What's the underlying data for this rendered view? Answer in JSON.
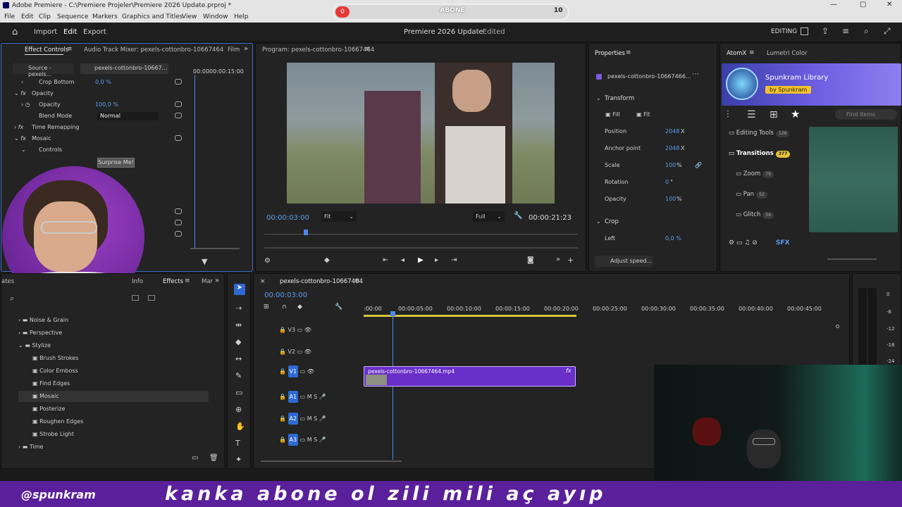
{
  "app": {
    "title": "Adobe Premiere - C:\\Premiere Projeler\\Premiere 2026 Update.prproj *",
    "menu": [
      "File",
      "Edit",
      "Clip",
      "Sequence",
      "Markers",
      "Graphics and Titles",
      "View",
      "Window",
      "Help"
    ]
  },
  "overlay": {
    "sub_left": "0",
    "sub_label": "ABONE",
    "sub_right": "10",
    "handle": "@spunkram",
    "ticker": "kanka abone ol zili mili aç ayıp"
  },
  "header": {
    "nav": [
      "Import",
      "Edit",
      "Export"
    ],
    "project": "Premiere 2026 Update",
    "status": "- Edited",
    "workspace": "EDITING"
  },
  "effect_controls": {
    "tabs": [
      "Effect Controls",
      "Audio Track Mixer: pexels-cottonbro-10667464",
      "Film"
    ],
    "source": "Source - pexels...",
    "clip": "pexels-cottonbro-10667...",
    "time_start": "00:00",
    "time_end": "00:00:15:00",
    "rows": [
      {
        "label": "Crop Bottom",
        "value": "0,0 %"
      },
      {
        "label": "Opacity",
        "value": ""
      },
      {
        "label": "Opacity",
        "value": "100,0 %"
      },
      {
        "label": "Blend Mode",
        "value": "Normal"
      },
      {
        "label": "Time Remapping",
        "value": ""
      },
      {
        "label": "Mosaic",
        "value": ""
      },
      {
        "label": "Controls",
        "value": ""
      }
    ],
    "tooltip": "Surprise Me!"
  },
  "program": {
    "title": "Program: pexels-cottonbro-10667464",
    "timecode": "00:00:03:00",
    "fit": "Fit",
    "quality": "Full",
    "duration": "00:00:21:23"
  },
  "properties": {
    "title": "Properties",
    "clip": "pexels-cottonbro-10667466...",
    "transform": "Transform",
    "fill": "Fill",
    "fit": "Fit",
    "rows": [
      {
        "label": "Position",
        "value": "2048",
        "unit": "X"
      },
      {
        "label": "Anchor point",
        "value": "2048",
        "unit": "X"
      },
      {
        "label": "Scale",
        "value": "100",
        "unit": "%"
      },
      {
        "label": "Rotation",
        "value": "0",
        "unit": "°"
      },
      {
        "label": "Opacity",
        "value": "100",
        "unit": "%"
      }
    ],
    "crop": "Crop",
    "left": "Left",
    "left_value": "0,0 %",
    "adjust": "Adjust speed..."
  },
  "atomx": {
    "tabs": [
      "AtomX",
      "Lumetri Color"
    ],
    "library": "Spunkram Library",
    "by": "by Spunkram",
    "search": "Find items",
    "categories": [
      {
        "label": "Editing Tools",
        "count": "126"
      },
      {
        "label": "Transitions",
        "count": "377"
      },
      {
        "label": "Zoom",
        "count": "79"
      },
      {
        "label": "Pan",
        "count": "52"
      },
      {
        "label": "Glitch",
        "count": "56"
      }
    ],
    "sfx": "SFX"
  },
  "effects": {
    "tabs": [
      "ates",
      "Info",
      "Effects",
      "Mar"
    ],
    "items": [
      "Noise & Grain",
      "Perspective",
      "Stylize",
      "Brush Strokes",
      "Color Emboss",
      "Find Edges",
      "Mosaic",
      "Posterize",
      "Roughen Edges",
      "Strobe Light",
      "Time"
    ]
  },
  "timeline": {
    "sequence": "pexels-cottonbro-10667464",
    "timecode": "00:00:03:00",
    "ruler": [
      ":00:00",
      "00:00:05:00",
      "00:00:10:00",
      "00:00:15:00",
      "00:00:20:00",
      "00:00:25:00",
      "00:00:30:00",
      "00:00:35:00",
      "00:00:40:00",
      "00:00:45:00"
    ],
    "tracks": [
      "V3",
      "V2",
      "V1",
      "A1",
      "A2",
      "A3"
    ],
    "clip": "pexels-cottonbro-10667464.mp4",
    "fx": "fx",
    "meter": [
      "0",
      "-6",
      "-12",
      "-18",
      "-24"
    ]
  }
}
